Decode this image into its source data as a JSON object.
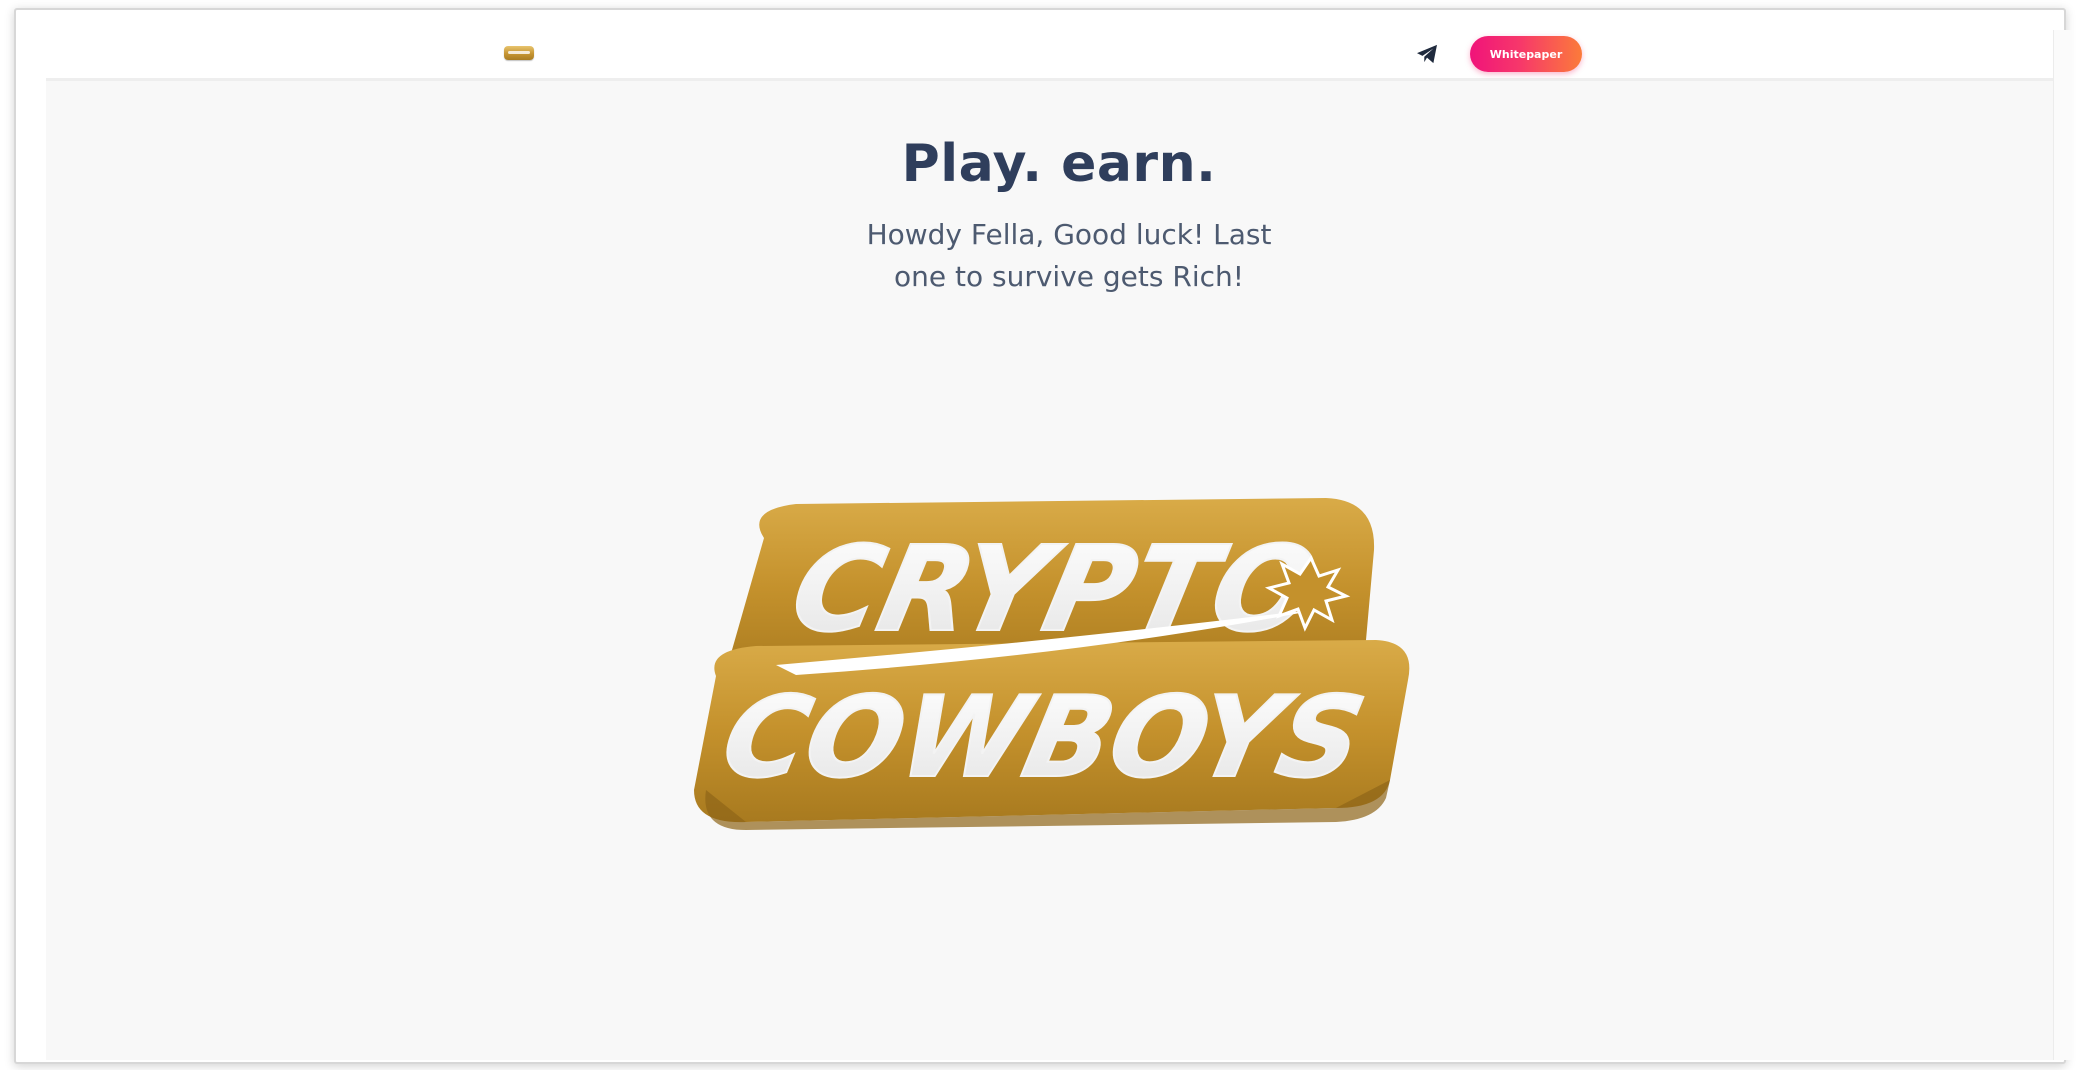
{
  "header": {
    "logo_icon": "gold-bar-icon",
    "social_icon": "telegram-icon",
    "whitepaper_label": "Whitepaper"
  },
  "hero": {
    "title": "Play. earn.",
    "subtitle_line1": "Howdy Fella, Good luck! Last",
    "subtitle_line2": "one to survive gets Rich!"
  },
  "brand_logo": {
    "line1": "CRYPTO",
    "line2": "COWBOYS"
  },
  "colors": {
    "gold": "#c8962e",
    "title": "#2f3e5c",
    "button_start": "#f0137a",
    "button_end": "#fb7b3a"
  }
}
